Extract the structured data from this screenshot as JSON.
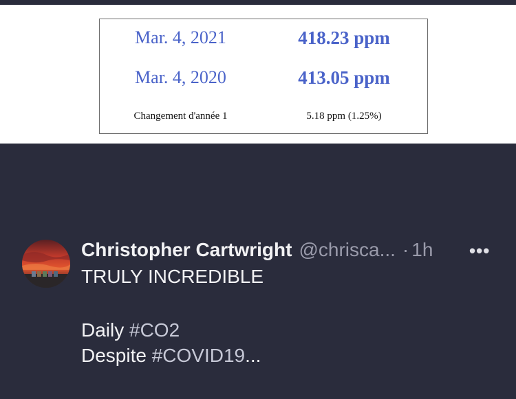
{
  "image": {
    "rows": [
      {
        "date": "Mar. 4, 2021",
        "ppm": "418.23 ppm"
      },
      {
        "date": "Mar. 4, 2020",
        "ppm": "413.05 ppm"
      }
    ],
    "change_label": "Changement d'année 1",
    "change_value": "5.18 ppm (1.25%)"
  },
  "tweet": {
    "author_name": "Christopher Cartwright",
    "handle": "@chrisca...",
    "separator": "·",
    "time": "1h",
    "more_icon": "more-horizontal-icon",
    "line1": "TRULY INCREDIBLE",
    "line2_prefix": "Daily ",
    "line2_tag": "#CO2",
    "line3_prefix": "Despite ",
    "line3_tag": "#COVID19",
    "line3_suffix": "..."
  },
  "colors": {
    "background": "#2a2c3c",
    "accent_blue": "#4a63c9",
    "text": "#f2f2f4",
    "muted": "#9a9bab"
  }
}
